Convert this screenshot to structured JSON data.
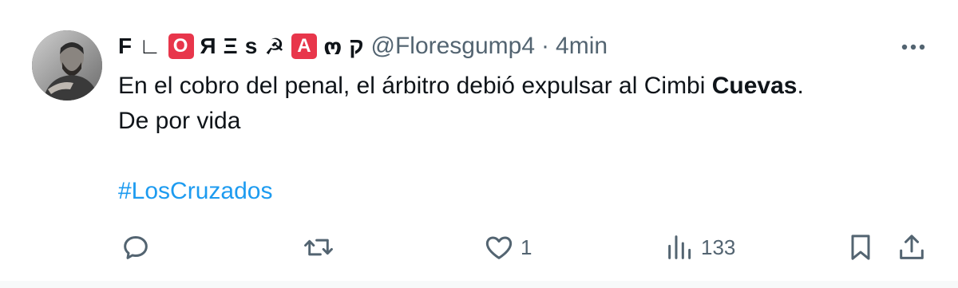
{
  "tweet": {
    "author": {
      "name_chars": [
        {
          "ch": "F",
          "boxed": false
        },
        {
          "ch": "∟",
          "boxed": false
        },
        {
          "ch": "O",
          "boxed": true
        },
        {
          "ch": "Я",
          "boxed": false
        },
        {
          "ch": "Ξ",
          "boxed": false
        },
        {
          "ch": "s",
          "boxed": false
        },
        {
          "ch": "☭",
          "boxed": false
        },
        {
          "ch": "A",
          "boxed": true
        },
        {
          "ch": "ო",
          "boxed": false
        },
        {
          "ch": "ק",
          "boxed": false
        }
      ],
      "handle": "@Floresgump4",
      "separator": "·",
      "time": "4min",
      "avatar_icon": "user-photo-avatar"
    },
    "text": {
      "line1_prefix": "En el cobro del penal, el árbitro debió expulsar al Cimbi ",
      "line1_bold": "Cuevas",
      "line1_suffix": ".",
      "line2": "De por vida",
      "hashtag": "#LosCruzados"
    },
    "actions": {
      "reply": {
        "icon": "reply-icon",
        "count": ""
      },
      "retweet": {
        "icon": "retweet-icon",
        "count": ""
      },
      "like": {
        "icon": "heart-icon",
        "count": "1"
      },
      "views": {
        "icon": "views-chart-icon",
        "count": "133"
      },
      "bookmark": {
        "icon": "bookmark-icon"
      },
      "share": {
        "icon": "share-icon"
      }
    },
    "colors": {
      "text": "#0f1419",
      "secondary": "#536471",
      "link": "#1d9bf0",
      "name_badge": "#e8364b",
      "background": "#ffffff",
      "page_background": "#f7f9f9"
    }
  }
}
